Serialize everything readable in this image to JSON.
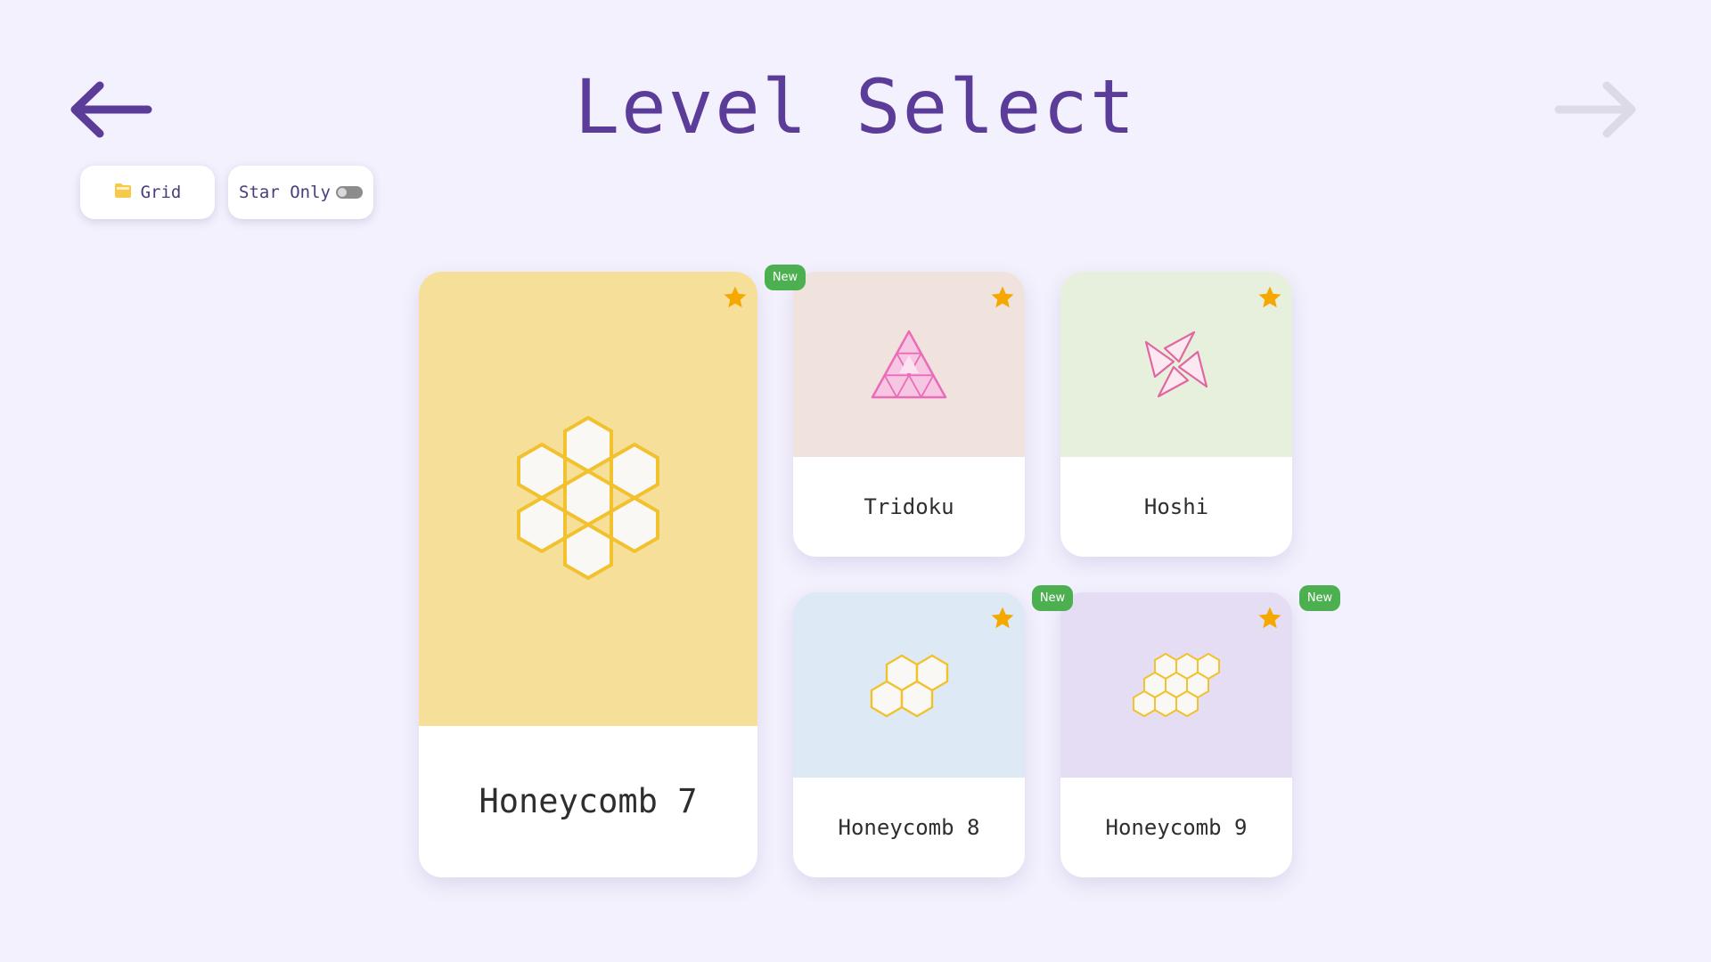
{
  "header": {
    "title": "Level Select",
    "back_icon": "arrow-left-icon",
    "forward_icon": "arrow-right-icon"
  },
  "filters": {
    "grid": {
      "icon": "folder-icon",
      "label": "Grid"
    },
    "star_only": {
      "label": "Star Only",
      "enabled": false
    }
  },
  "levels": [
    {
      "name": "Honeycomb 7",
      "icon": "honeycomb-7-icon",
      "starred": true,
      "is_new": false,
      "badge": "",
      "bg_color": "#f6df98"
    },
    {
      "name": "Tridoku",
      "icon": "triangle-grid-icon",
      "starred": true,
      "is_new": true,
      "badge": "New",
      "bg_color": "#f0e2dc"
    },
    {
      "name": "Hoshi",
      "icon": "hoshi-star-icon",
      "starred": true,
      "is_new": false,
      "badge": "",
      "bg_color": "#e7f0dc"
    },
    {
      "name": "Honeycomb 8",
      "icon": "honeycomb-8-icon",
      "starred": true,
      "is_new": true,
      "badge": "New",
      "bg_color": "#dee9f6"
    },
    {
      "name": "Honeycomb 9",
      "icon": "honeycomb-9-icon",
      "starred": true,
      "is_new": true,
      "badge": "New",
      "bg_color": "#e5ddf4"
    }
  ],
  "colors": {
    "background": "#f3f1fd",
    "title": "#5b3d99",
    "star": "#f5a800",
    "badge": "#4caf50",
    "honeycomb_stroke": "#f2c12e",
    "tridoku_stroke": "#ea6cb8"
  }
}
